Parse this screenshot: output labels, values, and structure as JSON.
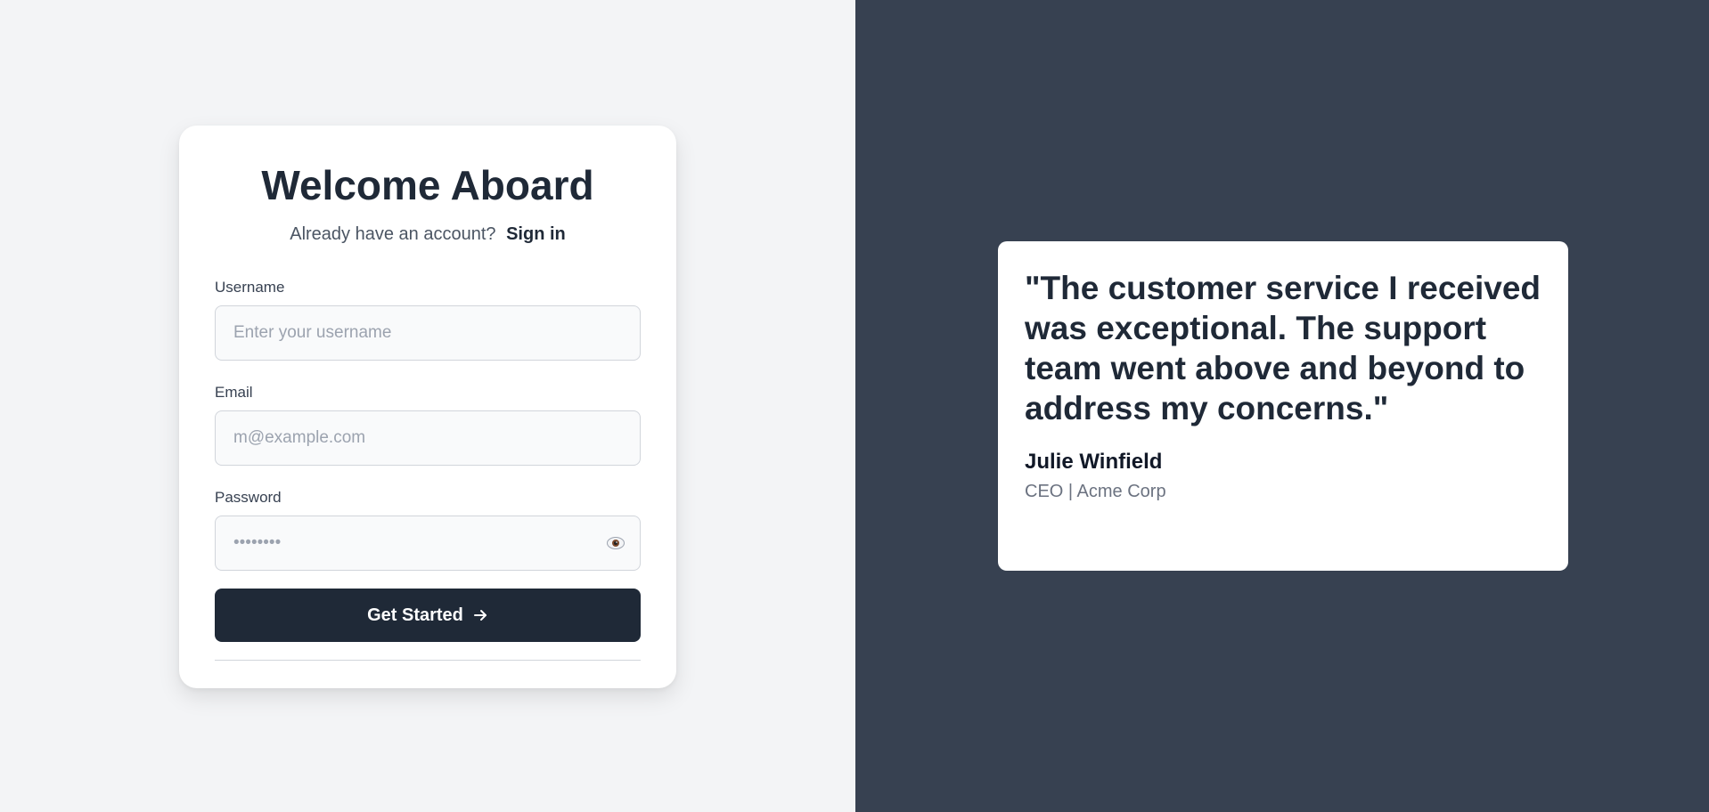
{
  "signup": {
    "title": "Welcome Aboard",
    "subtitle_text": "Already have an account?",
    "signin_link": "Sign in",
    "username": {
      "label": "Username",
      "placeholder": "Enter your username",
      "value": ""
    },
    "email": {
      "label": "Email",
      "placeholder": "m@example.com",
      "value": ""
    },
    "password": {
      "label": "Password",
      "placeholder": "••••••••",
      "value": ""
    },
    "submit_label": "Get Started",
    "submit_icon": "arrow-right-icon",
    "password_toggle_icon": "eye-icon"
  },
  "testimonial": {
    "quote": "\"The customer service I received was exceptional. The support team went above and beyond to address my concerns.\"",
    "author": "Julie Winfield",
    "role": "CEO | Acme Corp"
  },
  "colors": {
    "left_bg": "#f3f4f6",
    "right_bg": "#374151",
    "primary": "#1f2937"
  }
}
